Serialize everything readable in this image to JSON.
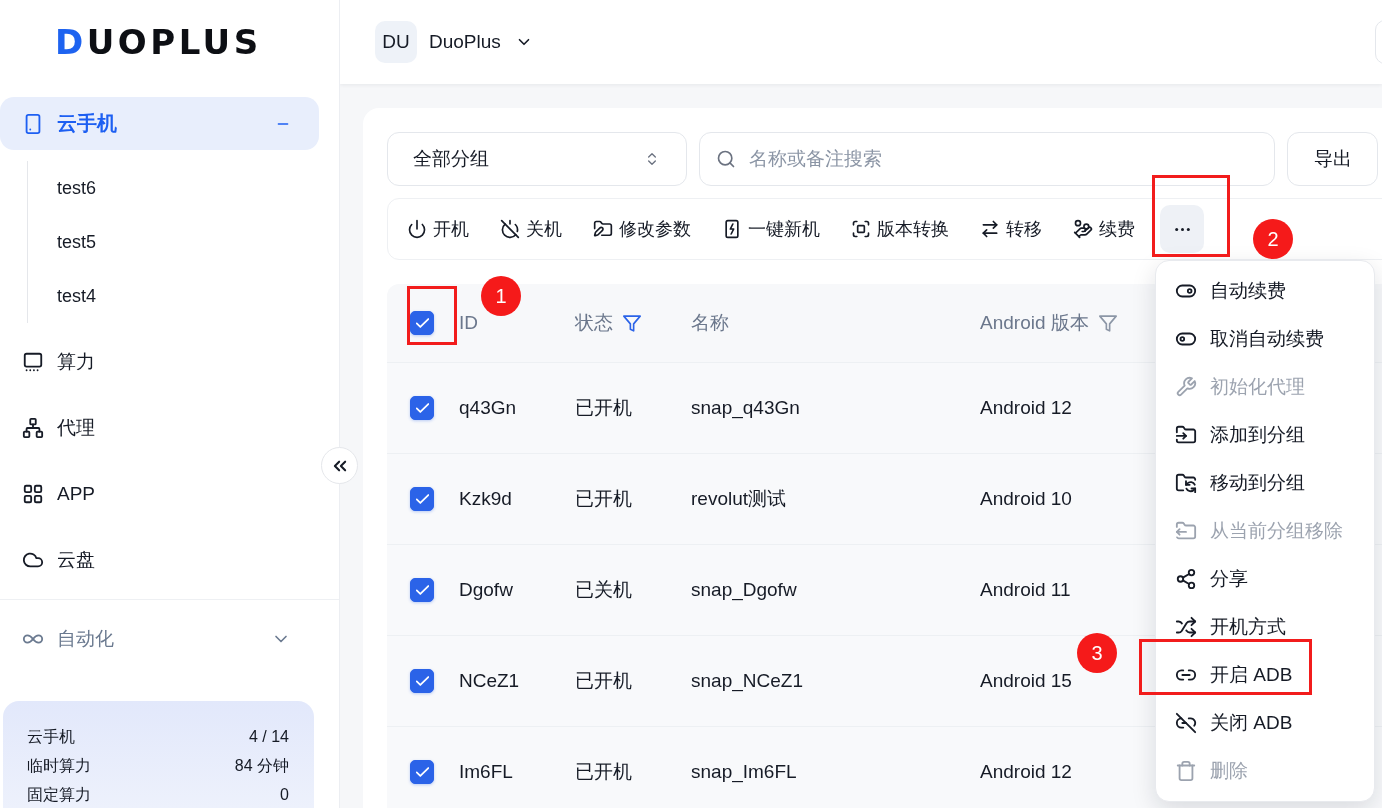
{
  "sidebar": {
    "logo": "DUOPLUS",
    "nav": [
      {
        "label": "云手机",
        "selected": true,
        "expanded": true,
        "children": [
          {
            "label": "test6",
            "selected": false
          },
          {
            "label": "test5",
            "selected": false
          },
          {
            "label": "test4",
            "selected": false
          }
        ]
      },
      {
        "label": "算力",
        "selected": false
      },
      {
        "label": "代理",
        "selected": false
      },
      {
        "label": "APP",
        "selected": false
      },
      {
        "label": "云盘",
        "selected": false
      }
    ],
    "groups": [
      {
        "label": "自动化",
        "expanded": false
      }
    ],
    "stats": [
      {
        "label": "云手机",
        "value": "4 / 14"
      },
      {
        "label": "临时算力",
        "value": "84 分钟"
      },
      {
        "label": "固定算力",
        "value": "0"
      }
    ]
  },
  "header": {
    "workspace": {
      "avatar": "DU",
      "name": "DuoPlus"
    }
  },
  "filters": {
    "group_select": {
      "value": "全部分组"
    },
    "search": {
      "placeholder": "名称或备注搜索"
    },
    "export_button": "导出"
  },
  "toolbar": {
    "actions": [
      "开机",
      "关机",
      "修改参数",
      "一键新机",
      "版本转换",
      "转移",
      "续费"
    ],
    "more": {
      "open": true,
      "callout": "2",
      "menu": [
        {
          "label": "自动续费",
          "disabled": false
        },
        {
          "label": "取消自动续费",
          "disabled": false
        },
        {
          "label": "初始化代理",
          "disabled": true
        },
        {
          "label": "添加到分组",
          "disabled": false
        },
        {
          "label": "移动到分组",
          "disabled": false
        },
        {
          "label": "从当前分组移除",
          "disabled": true
        },
        {
          "label": "分享",
          "disabled": false
        },
        {
          "label": "开机方式",
          "disabled": false
        },
        {
          "label": "开启 ADB",
          "disabled": false,
          "callout": "3"
        },
        {
          "label": "关闭 ADB",
          "disabled": false
        },
        {
          "label": "删除",
          "disabled": true
        }
      ]
    }
  },
  "table": {
    "select_all": {
      "checked": true,
      "callout": "1"
    },
    "columns": [
      {
        "label": "ID"
      },
      {
        "label": "状态",
        "filter_active": true
      },
      {
        "label": "名称"
      },
      {
        "label": "Android 版本",
        "filter_active": false
      }
    ],
    "rows": [
      {
        "selected": true,
        "cells": [
          "q43Gn",
          "已开机",
          "snap_q43Gn",
          "Android 12"
        ]
      },
      {
        "selected": true,
        "cells": [
          "Kzk9d",
          "已开机",
          "revolut测试",
          "Android 10"
        ]
      },
      {
        "selected": true,
        "cells": [
          "Dgofw",
          "已关机",
          "snap_Dgofw",
          "Android 11"
        ]
      },
      {
        "selected": true,
        "cells": [
          "NCeZ1",
          "已开机",
          "snap_NCeZ1",
          "Android 15"
        ]
      },
      {
        "selected": true,
        "cells": [
          "Im6FL",
          "已开机",
          "snap_Im6FL",
          "Android 12"
        ]
      }
    ]
  }
}
